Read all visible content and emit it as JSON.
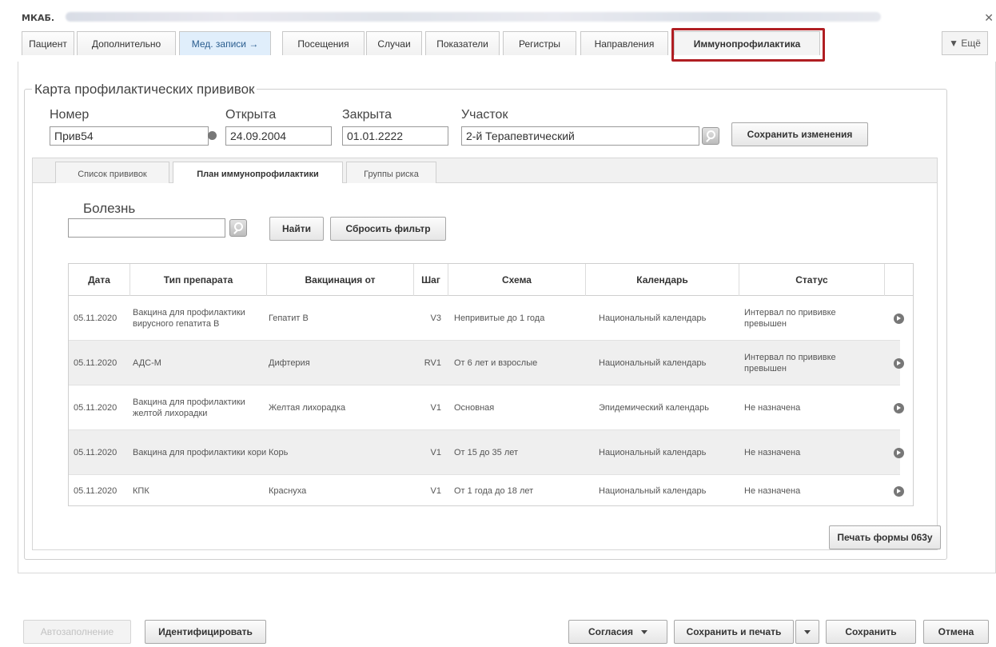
{
  "window": {
    "title": "МКАБ."
  },
  "tabs": [
    {
      "label": "Пациент"
    },
    {
      "label": "Дополнительно"
    },
    {
      "label": "Мед. записи →"
    },
    {
      "label": "Посещения"
    },
    {
      "label": "Случаи"
    },
    {
      "label": "Показатели"
    },
    {
      "label": "Регистры"
    },
    {
      "label": "Направления"
    },
    {
      "label": "Иммунопрофилактика"
    }
  ],
  "more_label": "▼ Ещё",
  "card": {
    "legend": "Карта профилактических прививок",
    "number_label": "Номер",
    "number_value": "Прив54",
    "opened_label": "Открыта",
    "opened_value": "24.09.2004",
    "closed_label": "Закрыта",
    "closed_value": "01.01.2222",
    "area_label": "Участок",
    "area_value": "2-й Терапевтический",
    "save_changes": "Сохранить изменения"
  },
  "subtabs": [
    {
      "label": "Список прививок"
    },
    {
      "label": "План иммунопрофилактики"
    },
    {
      "label": "Группы риска"
    }
  ],
  "filter": {
    "disease_label": "Болезнь",
    "disease_value": "",
    "find": "Найти",
    "reset": "Сбросить фильтр"
  },
  "table": {
    "columns": [
      "Дата",
      "Тип препарата",
      "Вакцинация от",
      "Шаг",
      "Схема",
      "Календарь",
      "Статус"
    ],
    "rows": [
      {
        "date": "05.11.2020",
        "drug": "Вакцина для профилактики вирусного гепатита В",
        "against": "Гепатит В",
        "step": "V3",
        "scheme": "Непривитые до 1 года",
        "calendar": "Национальный календарь",
        "status": "Интервал по прививке превышен"
      },
      {
        "date": "05.11.2020",
        "drug": "АДС-М",
        "against": "Дифтерия",
        "step": "RV1",
        "scheme": "От 6 лет и взрослые",
        "calendar": "Национальный календарь",
        "status": "Интервал по прививке превышен"
      },
      {
        "date": "05.11.2020",
        "drug": "Вакцина для профилактики желтой лихорадки",
        "against": "Желтая лихорадка",
        "step": "V1",
        "scheme": "Основная",
        "calendar": "Эпидемический календарь",
        "status": "Не назначена"
      },
      {
        "date": "05.11.2020",
        "drug": "Вакцина для профилактики кори",
        "against": "Корь",
        "step": "V1",
        "scheme": "От 15 до 35 лет",
        "calendar": "Национальный календарь",
        "status": "Не назначена"
      },
      {
        "date": "05.11.2020",
        "drug": "КПК",
        "against": "Краснуха",
        "step": "V1",
        "scheme": "От 1 года до 18 лет",
        "calendar": "Национальный календарь",
        "status": "Не назначена"
      }
    ]
  },
  "print_063": "Печать формы 063у",
  "footer": {
    "autofill": "Автозаполнение",
    "identify": "Идентифицировать",
    "consents": "Согласия",
    "save_print": "Сохранить и печать",
    "save": "Сохранить",
    "cancel": "Отмена"
  },
  "colors": {
    "highlight": "#b01e22",
    "active_tab": "#e0eefb"
  }
}
